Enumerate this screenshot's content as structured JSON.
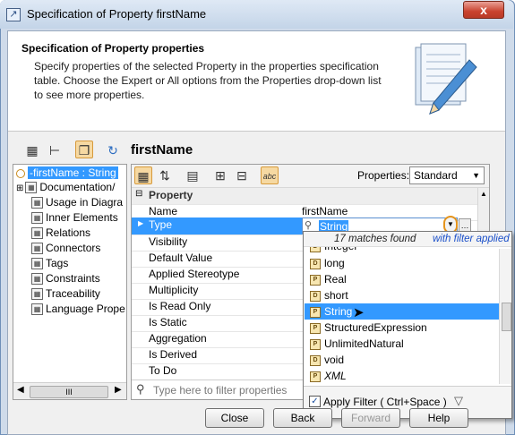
{
  "window": {
    "title": "Specification of Property firstName",
    "close_symbol": "x"
  },
  "header": {
    "title": "Specification of Property properties",
    "description": "Specify properties of the selected Property in the properties specification table. Choose the Expert or All options from the Properties drop-down list to see more properties."
  },
  "element_name": "firstName",
  "tree": {
    "items": [
      {
        "label": "-firstName : String",
        "selected": true,
        "icon": "property-circle-icon"
      },
      {
        "label": "Documentation/",
        "icon": "node-icon"
      },
      {
        "label": "Usage in Diagra",
        "icon": "node-icon"
      },
      {
        "label": "Inner Elements",
        "icon": "node-icon"
      },
      {
        "label": "Relations",
        "icon": "node-icon"
      },
      {
        "label": "Connectors",
        "icon": "node-icon"
      },
      {
        "label": "Tags",
        "icon": "node-icon"
      },
      {
        "label": "Constraints",
        "icon": "node-icon"
      },
      {
        "label": "Traceability",
        "icon": "node-icon"
      },
      {
        "label": "Language Prope",
        "icon": "node-icon"
      }
    ],
    "scroll_thumb_text": "III"
  },
  "properties_toolbar": {
    "properties_label": "Properties:",
    "properties_value": "Standard",
    "abc_label": "abc"
  },
  "property_table": {
    "group_label": "Property",
    "rows": [
      {
        "name": "Name",
        "value": "firstName"
      },
      {
        "name": "Type",
        "value": "String",
        "selected": true
      },
      {
        "name": "Visibility",
        "value": ""
      },
      {
        "name": "Default Value",
        "value": ""
      },
      {
        "name": "Applied Stereotype",
        "value": ""
      },
      {
        "name": "Multiplicity",
        "value": ""
      },
      {
        "name": "Is Read Only",
        "value": ""
      },
      {
        "name": "Is Static",
        "value": ""
      },
      {
        "name": "Aggregation",
        "value": ""
      },
      {
        "name": "Is Derived",
        "value": ""
      },
      {
        "name": "To Do",
        "value": ""
      }
    ]
  },
  "filter": {
    "placeholder": "Type here to filter properties"
  },
  "type_dropdown": {
    "matches_count": "17 matches found",
    "matches_suffix": "with filter applied",
    "items": [
      {
        "label": "Integer",
        "icon": "datatype-icon"
      },
      {
        "label": "long",
        "icon": "datatype-icon"
      },
      {
        "label": "Real",
        "icon": "primitive-icon"
      },
      {
        "label": "short",
        "icon": "datatype-icon"
      },
      {
        "label": "String",
        "icon": "primitive-icon",
        "selected": true
      },
      {
        "label": "StructuredExpression",
        "icon": "primitive-icon"
      },
      {
        "label": "UnlimitedNatural",
        "icon": "primitive-icon"
      },
      {
        "label": "void",
        "icon": "datatype-icon"
      },
      {
        "label": "XML",
        "icon": "primitive-icon"
      }
    ],
    "apply_filter_label": "Apply Filter ( Ctrl+Space )",
    "apply_filter_checked": true
  },
  "buttons": {
    "close": "Close",
    "back": "Back",
    "forward": "Forward",
    "help": "Help"
  }
}
